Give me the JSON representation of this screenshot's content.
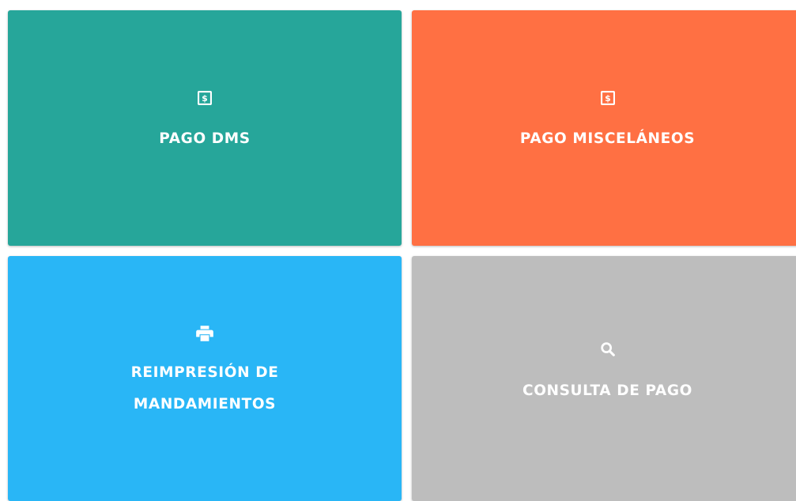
{
  "tiles": [
    {
      "key": "pago_dms",
      "label": "PAGO DMS",
      "icon": "money-icon",
      "color": "#26a69a"
    },
    {
      "key": "pago_misc",
      "label": "PAGO MISCELÁNEOS",
      "icon": "money-icon",
      "color": "#ff7043"
    },
    {
      "key": "reimpresion",
      "label_line1": "REIMPRESIÓN DE",
      "label_line2": "MANDAMIENTOS",
      "icon": "print-icon",
      "color": "#29b6f6"
    },
    {
      "key": "consulta",
      "label": "CONSULTA DE PAGO",
      "icon": "search-icon",
      "color": "#bdbdbd"
    }
  ]
}
